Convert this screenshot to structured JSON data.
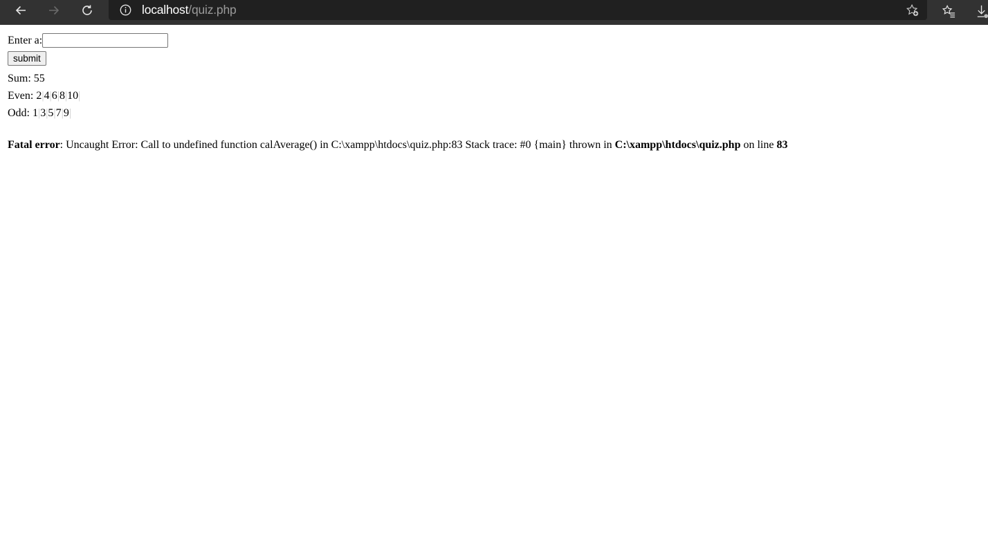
{
  "browser": {
    "url_host": "localhost",
    "url_path": "/quiz.php",
    "icons": [
      "back-arrow-icon",
      "forward-arrow-icon",
      "refresh-icon",
      "info-icon",
      "add-favorite-icon",
      "favorites-list-icon",
      "downloads-icon"
    ]
  },
  "form": {
    "label": "Enter a:",
    "input_value": "",
    "submit_label": "submit"
  },
  "results": {
    "sum_label": "Sum: ",
    "sum_value": "55",
    "even_label": "Even: ",
    "even_values": [
      "2",
      "4",
      "6",
      "8",
      "10"
    ],
    "odd_label": "Odd: ",
    "odd_values": [
      "1",
      "3",
      "5",
      "7",
      "9"
    ]
  },
  "error": {
    "title": "Fatal error",
    "message": ": Uncaught Error: Call to undefined function calAverage() in C:\\xampp\\htdocs\\quiz.php:83 Stack trace: #0 {main} thrown in ",
    "file": "C:\\xampp\\htdocs\\quiz.php",
    "on_line_text": " on line ",
    "line": "83"
  }
}
